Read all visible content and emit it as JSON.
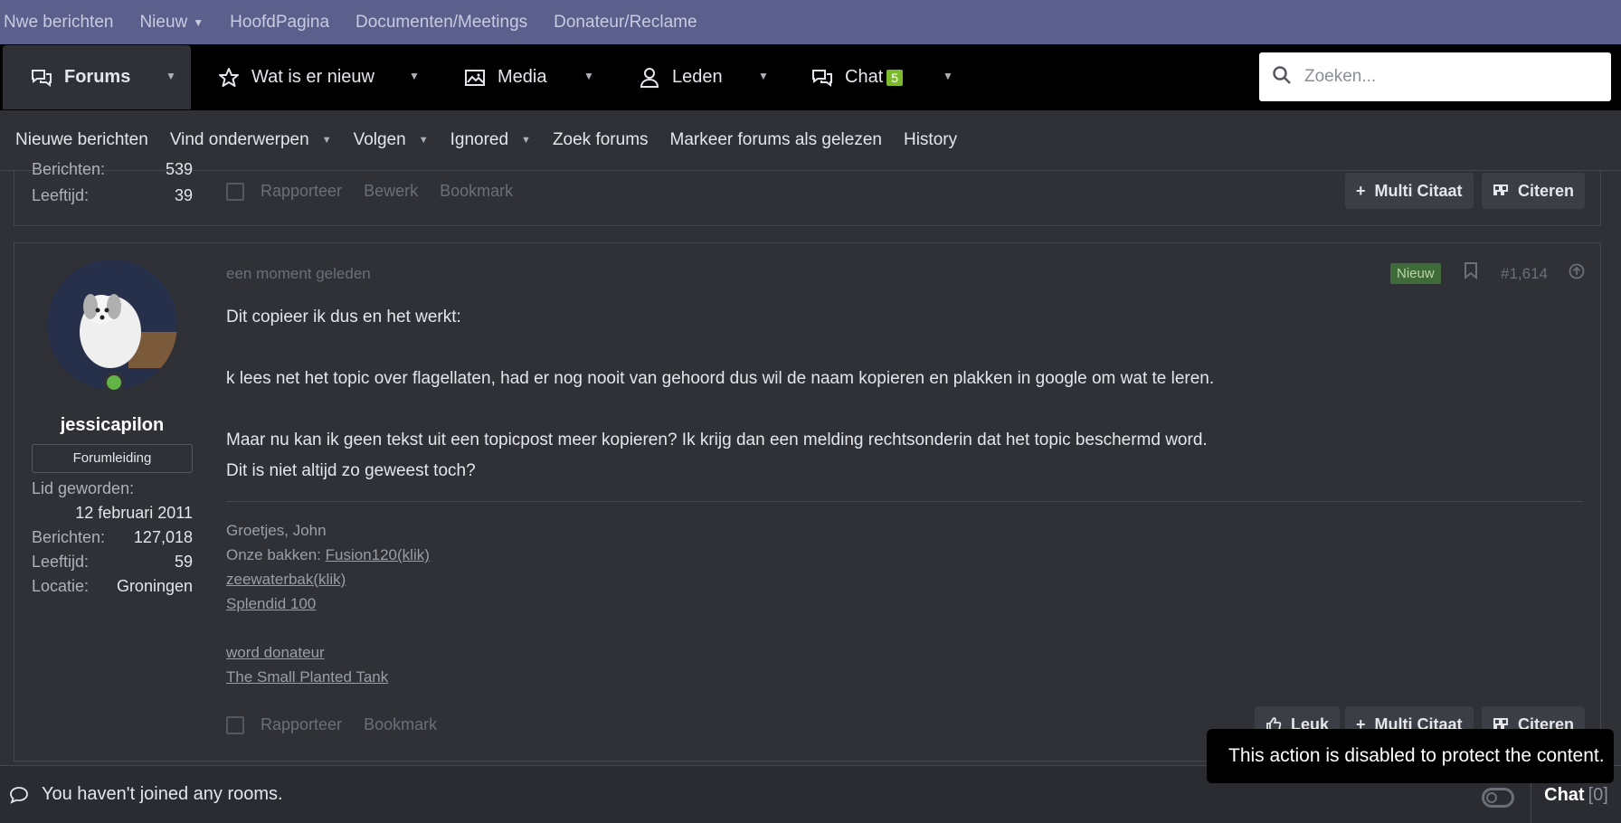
{
  "topbar": {
    "items": [
      "Nwe berichten",
      "Nieuw",
      "HoofdPagina",
      "Documenten/Meetings",
      "Donateur/Reclame"
    ]
  },
  "mainnav": {
    "forums": "Forums",
    "whats_new": "Wat is er nieuw",
    "media": "Media",
    "members": "Leden",
    "chat": "Chat",
    "chat_badge": "5",
    "search_placeholder": "Zoeken..."
  },
  "subnav": {
    "items": [
      "Nieuwe berichten",
      "Vind onderwerpen",
      "Volgen",
      "Ignored",
      "Zoek forums",
      "Markeer forums als gelezen",
      "History"
    ]
  },
  "post1": {
    "stats": [
      {
        "label": "Berichten:",
        "value": "539"
      },
      {
        "label": "Leeftijd:",
        "value": "39"
      }
    ],
    "actions": {
      "report": "Rapporteer",
      "edit": "Bewerk",
      "bookmark": "Bookmark"
    },
    "multiquote": "Multi Citaat",
    "quote": "Citeren"
  },
  "post2": {
    "username": "jessicapilon",
    "role": "Forumleiding",
    "joined_label": "Lid geworden:",
    "joined_value": "12 februari 2011",
    "stats": [
      {
        "label": "Berichten:",
        "value": "127,018"
      },
      {
        "label": "Leeftijd:",
        "value": "59"
      },
      {
        "label": "Locatie:",
        "value": "Groningen"
      }
    ],
    "time": "een moment geleden",
    "new_badge": "Nieuw",
    "post_number": "#1,614",
    "body": [
      "Dit copieer ik dus en het werkt:",
      "k lees net het topic over flagellaten, had er nog nooit van gehoord dus wil de naam kopieren en plakken in google om wat te leren.",
      "Maar nu kan ik geen tekst uit een topicpost meer kopieren? Ik krijg dan een melding rechtsonderin dat het topic beschermd word.",
      "Dit is niet altijd zo geweest toch?"
    ],
    "signature": {
      "greeting": "Groetjes, John",
      "tanks_label": "Onze bakken: ",
      "links": [
        "Fusion120(klik)",
        "zeewaterbak(klik)",
        "Splendid 100",
        "word donateur",
        "The Small Planted Tank"
      ]
    },
    "actions": {
      "report": "Rapporteer",
      "bookmark": "Bookmark"
    },
    "like": "Leuk",
    "multiquote": "Multi Citaat",
    "quote": "Citeren"
  },
  "chatbar": {
    "message": "You haven't joined any rooms.",
    "label": "Chat",
    "count": "[0]"
  },
  "toast": "This action is disabled to protect the content.",
  "colors": {
    "topbar": "#5a5f8c",
    "nav": "#000000",
    "background": "#2f3136",
    "new_badge": "#3f6a3a",
    "chat_badge": "#7cb92d",
    "online": "#63b346"
  }
}
